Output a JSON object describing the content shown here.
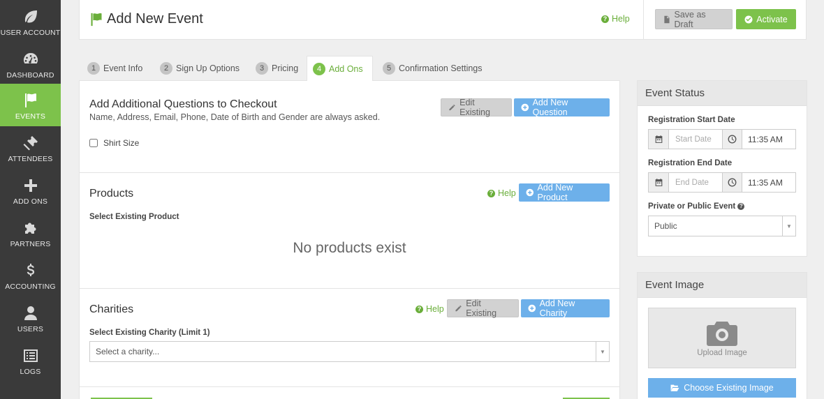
{
  "sidebar": {
    "items": [
      {
        "label": "User Account",
        "icon": "leaf-icon",
        "active": false
      },
      {
        "label": "Dashboard",
        "icon": "dashboard-icon",
        "active": false
      },
      {
        "label": "Events",
        "icon": "flag-icon",
        "active": true
      },
      {
        "label": "Attendees",
        "icon": "ticket-icon",
        "active": false
      },
      {
        "label": "Add Ons",
        "icon": "plus-icon",
        "active": false
      },
      {
        "label": "Partners",
        "icon": "puzzle-icon",
        "active": false
      },
      {
        "label": "Accounting",
        "icon": "dollar-icon",
        "active": false
      },
      {
        "label": "Users",
        "icon": "user-icon",
        "active": false
      },
      {
        "label": "Logs",
        "icon": "list-icon",
        "active": false
      }
    ]
  },
  "header": {
    "title": "Add New Event",
    "help": "Help",
    "save_draft": "Save as Draft",
    "activate": "Activate"
  },
  "tabs": [
    {
      "num": "1",
      "label": "Event Info",
      "active": false
    },
    {
      "num": "2",
      "label": "Sign Up Options",
      "active": false
    },
    {
      "num": "3",
      "label": "Pricing",
      "active": false
    },
    {
      "num": "4",
      "label": "Add Ons",
      "active": true
    },
    {
      "num": "5",
      "label": "Confirmation Settings",
      "active": false
    }
  ],
  "questions": {
    "title": "Add Additional Questions to Checkout",
    "subtitle": "Name, Address, Email, Phone, Date of Birth and Gender are always asked.",
    "edit_existing": "Edit Existing",
    "add_new": "Add New Question",
    "checkbox_label": "Shirt Size",
    "checkbox_checked": false
  },
  "products": {
    "title": "Products",
    "help": "Help",
    "add_new": "Add New Product",
    "select_label": "Select Existing Product",
    "empty_message": "No products exist"
  },
  "charities": {
    "title": "Charities",
    "help": "Help",
    "edit_existing": "Edit Existing",
    "add_new": "Add New Charity",
    "select_label": "Select Existing Charity (Limit 1)",
    "select_placeholder": "Select a charity..."
  },
  "event_status": {
    "title": "Event Status",
    "start_label": "Registration Start Date",
    "start_placeholder": "Start Date",
    "start_time": "11:35 AM",
    "end_label": "Registration End Date",
    "end_placeholder": "End Date",
    "end_time": "11:35 AM",
    "visibility_label": "Private or Public Event",
    "visibility_value": "Public"
  },
  "event_image": {
    "title": "Event Image",
    "upload_label": "Upload Image",
    "choose_existing": "Choose Existing Image"
  },
  "colors": {
    "accent_green": "#7dc24b",
    "button_blue": "#6db0ea",
    "sidebar_bg": "#3a3a3a"
  }
}
